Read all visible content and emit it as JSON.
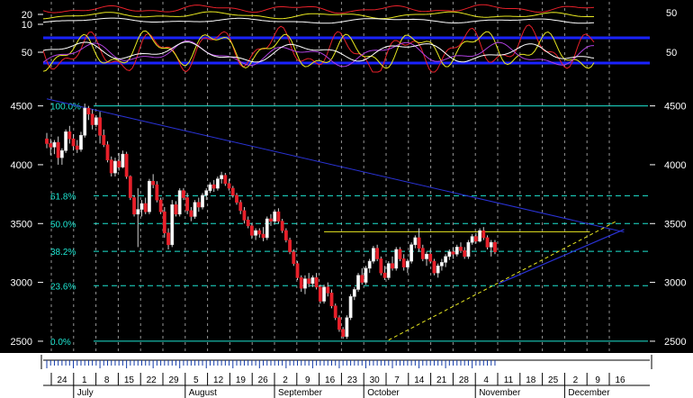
{
  "chart_data": {
    "type": "candlestick",
    "colors": {
      "background": "#000000",
      "axis_panel": "#ffffff",
      "up_candle": "#ffffff",
      "down_candle": "#e8202a",
      "wick": "#cfcfcf",
      "fib_lines": "#1ee6d2",
      "trendlines": "#2a33d6",
      "resistance": "#e8e820",
      "support_dashed": "#e8e820",
      "vgrid": "#c8c8c8",
      "osc_bands": "#1a22ff"
    },
    "indicator_panel": {
      "left_ticks": [
        "20",
        "10",
        "50"
      ],
      "right_ticks": [
        "50",
        "50"
      ],
      "band_levels": [
        80,
        20
      ],
      "lines": [
        {
          "color": "#e8202a",
          "kind": "upper"
        },
        {
          "color": "#e8e820",
          "kind": "upper"
        },
        {
          "color": "#ffffff",
          "kind": "upper"
        },
        {
          "color": "#e8202a",
          "kind": "oscillator"
        },
        {
          "color": "#e8e820",
          "kind": "oscillator"
        },
        {
          "color": "#b040e0",
          "kind": "oscillator"
        },
        {
          "color": "#ffffff",
          "kind": "oscillator"
        }
      ]
    },
    "price_axis": {
      "min": 2400,
      "max": 4650,
      "ticks": [
        "2500",
        "3000",
        "3500",
        "4000",
        "4500"
      ]
    },
    "fibonacci": {
      "high": 4500,
      "low": 2500,
      "levels": [
        {
          "label": "100.0%",
          "value": 4500
        },
        {
          "label": "61.8%",
          "value": 3736
        },
        {
          "label": "50.0%",
          "value": 3500
        },
        {
          "label": "38.2%",
          "value": 3264
        },
        {
          "label": "23.6%",
          "value": 2972
        },
        {
          "label": "0.0%",
          "value": 2500
        }
      ]
    },
    "resistance": {
      "value": 3430,
      "from_bar": 73,
      "to_bar": 143
    },
    "trendlines": [
      {
        "from": [
          0,
          4560
        ],
        "to": [
          145,
          3480
        ],
        "extend_to": 152
      },
      {
        "from": [
          119,
          2990
        ],
        "to": [
          152,
          3450
        ]
      }
    ],
    "support_dashed": {
      "from": [
        90,
        2510
      ],
      "to": [
        150,
        3520
      ]
    },
    "x_axis": {
      "day_labels": [
        "24",
        "1",
        "8",
        "15",
        "22",
        "29",
        "5",
        "12",
        "19",
        "26",
        "2",
        "9",
        "16",
        "23",
        "30",
        "7",
        "14",
        "21",
        "28",
        "4",
        "11",
        "18",
        "25",
        "2",
        "9",
        "16"
      ],
      "months": [
        {
          "label": "July",
          "at": 1
        },
        {
          "label": "August",
          "at": 6
        },
        {
          "label": "September",
          "at": 10
        },
        {
          "label": "October",
          "at": 14
        },
        {
          "label": "November",
          "at": 19
        },
        {
          "label": "December",
          "at": 23
        }
      ]
    },
    "candles": [
      {
        "o": 4220,
        "h": 4270,
        "l": 4140,
        "c": 4180
      },
      {
        "o": 4180,
        "h": 4220,
        "l": 4080,
        "c": 4150
      },
      {
        "o": 4150,
        "h": 4210,
        "l": 4090,
        "c": 4190
      },
      {
        "o": 4190,
        "h": 4240,
        "l": 4000,
        "c": 4060
      },
      {
        "o": 4060,
        "h": 4140,
        "l": 4000,
        "c": 4120
      },
      {
        "o": 4120,
        "h": 4300,
        "l": 4100,
        "c": 4280
      },
      {
        "o": 4280,
        "h": 4330,
        "l": 4180,
        "c": 4220
      },
      {
        "o": 4220,
        "h": 4260,
        "l": 4120,
        "c": 4160
      },
      {
        "o": 4160,
        "h": 4210,
        "l": 4100,
        "c": 4130
      },
      {
        "o": 4130,
        "h": 4280,
        "l": 4110,
        "c": 4250
      },
      {
        "o": 4250,
        "h": 4520,
        "l": 4230,
        "c": 4480
      },
      {
        "o": 4480,
        "h": 4500,
        "l": 4380,
        "c": 4430
      },
      {
        "o": 4430,
        "h": 4470,
        "l": 4300,
        "c": 4340
      },
      {
        "o": 4340,
        "h": 4420,
        "l": 4320,
        "c": 4400
      },
      {
        "o": 4400,
        "h": 4450,
        "l": 4180,
        "c": 4250
      },
      {
        "o": 4250,
        "h": 4300,
        "l": 4150,
        "c": 4170
      },
      {
        "o": 4170,
        "h": 4200,
        "l": 4020,
        "c": 4040
      },
      {
        "o": 4040,
        "h": 4070,
        "l": 3900,
        "c": 3930
      },
      {
        "o": 3930,
        "h": 4060,
        "l": 3900,
        "c": 4030
      },
      {
        "o": 4030,
        "h": 4100,
        "l": 3950,
        "c": 3980
      },
      {
        "o": 3980,
        "h": 4120,
        "l": 3970,
        "c": 4090
      },
      {
        "o": 4090,
        "h": 4110,
        "l": 3880,
        "c": 3900
      },
      {
        "o": 3900,
        "h": 3910,
        "l": 3700,
        "c": 3720
      },
      {
        "o": 3720,
        "h": 3740,
        "l": 3560,
        "c": 3580
      },
      {
        "o": 3580,
        "h": 3800,
        "l": 3300,
        "c": 3620
      },
      {
        "o": 3620,
        "h": 3700,
        "l": 3560,
        "c": 3670
      },
      {
        "o": 3670,
        "h": 3720,
        "l": 3580,
        "c": 3600
      },
      {
        "o": 3600,
        "h": 3880,
        "l": 3580,
        "c": 3860
      },
      {
        "o": 3860,
        "h": 3920,
        "l": 3800,
        "c": 3830
      },
      {
        "o": 3830,
        "h": 3860,
        "l": 3680,
        "c": 3700
      },
      {
        "o": 3700,
        "h": 3720,
        "l": 3580,
        "c": 3600
      },
      {
        "o": 3600,
        "h": 3640,
        "l": 3380,
        "c": 3420
      },
      {
        "o": 3420,
        "h": 3460,
        "l": 3280,
        "c": 3320
      },
      {
        "o": 3320,
        "h": 3700,
        "l": 3300,
        "c": 3660
      },
      {
        "o": 3660,
        "h": 3690,
        "l": 3560,
        "c": 3580
      },
      {
        "o": 3580,
        "h": 3800,
        "l": 3560,
        "c": 3780
      },
      {
        "o": 3780,
        "h": 3800,
        "l": 3700,
        "c": 3720
      },
      {
        "o": 3720,
        "h": 3760,
        "l": 3580,
        "c": 3610
      },
      {
        "o": 3610,
        "h": 3640,
        "l": 3520,
        "c": 3560
      },
      {
        "o": 3560,
        "h": 3700,
        "l": 3540,
        "c": 3680
      },
      {
        "o": 3680,
        "h": 3720,
        "l": 3600,
        "c": 3640
      },
      {
        "o": 3640,
        "h": 3760,
        "l": 3620,
        "c": 3740
      },
      {
        "o": 3740,
        "h": 3800,
        "l": 3700,
        "c": 3780
      },
      {
        "o": 3780,
        "h": 3850,
        "l": 3760,
        "c": 3830
      },
      {
        "o": 3830,
        "h": 3870,
        "l": 3770,
        "c": 3800
      },
      {
        "o": 3800,
        "h": 3900,
        "l": 3780,
        "c": 3880
      },
      {
        "o": 3880,
        "h": 3940,
        "l": 3840,
        "c": 3910
      },
      {
        "o": 3910,
        "h": 3930,
        "l": 3820,
        "c": 3840
      },
      {
        "o": 3840,
        "h": 3880,
        "l": 3780,
        "c": 3800
      },
      {
        "o": 3800,
        "h": 3820,
        "l": 3720,
        "c": 3740
      },
      {
        "o": 3740,
        "h": 3760,
        "l": 3660,
        "c": 3680
      },
      {
        "o": 3680,
        "h": 3700,
        "l": 3580,
        "c": 3610
      },
      {
        "o": 3610,
        "h": 3640,
        "l": 3500,
        "c": 3530
      },
      {
        "o": 3530,
        "h": 3560,
        "l": 3460,
        "c": 3480
      },
      {
        "o": 3480,
        "h": 3500,
        "l": 3370,
        "c": 3400
      },
      {
        "o": 3400,
        "h": 3460,
        "l": 3360,
        "c": 3440
      },
      {
        "o": 3440,
        "h": 3460,
        "l": 3380,
        "c": 3410
      },
      {
        "o": 3410,
        "h": 3470,
        "l": 3350,
        "c": 3380
      },
      {
        "o": 3380,
        "h": 3560,
        "l": 3360,
        "c": 3540
      },
      {
        "o": 3540,
        "h": 3580,
        "l": 3480,
        "c": 3520
      },
      {
        "o": 3520,
        "h": 3620,
        "l": 3500,
        "c": 3600
      },
      {
        "o": 3600,
        "h": 3630,
        "l": 3500,
        "c": 3520
      },
      {
        "o": 3520,
        "h": 3540,
        "l": 3420,
        "c": 3440
      },
      {
        "o": 3440,
        "h": 3460,
        "l": 3340,
        "c": 3360
      },
      {
        "o": 3360,
        "h": 3380,
        "l": 3240,
        "c": 3260
      },
      {
        "o": 3260,
        "h": 3280,
        "l": 3140,
        "c": 3160
      },
      {
        "o": 3160,
        "h": 3180,
        "l": 3020,
        "c": 3040
      },
      {
        "o": 3040,
        "h": 3060,
        "l": 2920,
        "c": 2950
      },
      {
        "o": 2950,
        "h": 3060,
        "l": 2900,
        "c": 3030
      },
      {
        "o": 3030,
        "h": 3080,
        "l": 2960,
        "c": 2990
      },
      {
        "o": 2990,
        "h": 3060,
        "l": 2960,
        "c": 3040
      },
      {
        "o": 3040,
        "h": 3080,
        "l": 2940,
        "c": 2960
      },
      {
        "o": 2960,
        "h": 2980,
        "l": 2820,
        "c": 2840
      },
      {
        "o": 2840,
        "h": 2980,
        "l": 2820,
        "c": 2960
      },
      {
        "o": 2960,
        "h": 3000,
        "l": 2880,
        "c": 2910
      },
      {
        "o": 2910,
        "h": 2940,
        "l": 2780,
        "c": 2800
      },
      {
        "o": 2800,
        "h": 2820,
        "l": 2680,
        "c": 2700
      },
      {
        "o": 2700,
        "h": 2720,
        "l": 2580,
        "c": 2600
      },
      {
        "o": 2600,
        "h": 2620,
        "l": 2520,
        "c": 2540
      },
      {
        "o": 2540,
        "h": 2720,
        "l": 2520,
        "c": 2700
      },
      {
        "o": 2700,
        "h": 2900,
        "l": 2680,
        "c": 2880
      },
      {
        "o": 2880,
        "h": 2960,
        "l": 2850,
        "c": 2940
      },
      {
        "o": 2940,
        "h": 3080,
        "l": 2920,
        "c": 3060
      },
      {
        "o": 3060,
        "h": 3120,
        "l": 2980,
        "c": 3000
      },
      {
        "o": 3000,
        "h": 3140,
        "l": 2980,
        "c": 3120
      },
      {
        "o": 3120,
        "h": 3200,
        "l": 3080,
        "c": 3180
      },
      {
        "o": 3180,
        "h": 3310,
        "l": 3160,
        "c": 3290
      },
      {
        "o": 3290,
        "h": 3320,
        "l": 3180,
        "c": 3200
      },
      {
        "o": 3200,
        "h": 3220,
        "l": 3060,
        "c": 3080
      },
      {
        "o": 3080,
        "h": 3140,
        "l": 3020,
        "c": 3040
      },
      {
        "o": 3040,
        "h": 3180,
        "l": 3020,
        "c": 3160
      },
      {
        "o": 3160,
        "h": 3220,
        "l": 3100,
        "c": 3120
      },
      {
        "o": 3120,
        "h": 3300,
        "l": 3100,
        "c": 3280
      },
      {
        "o": 3280,
        "h": 3300,
        "l": 3180,
        "c": 3200
      },
      {
        "o": 3200,
        "h": 3240,
        "l": 3100,
        "c": 3130
      },
      {
        "o": 3130,
        "h": 3200,
        "l": 3080,
        "c": 3180
      },
      {
        "o": 3180,
        "h": 3340,
        "l": 3160,
        "c": 3320
      },
      {
        "o": 3320,
        "h": 3400,
        "l": 3290,
        "c": 3380
      },
      {
        "o": 3380,
        "h": 3460,
        "l": 3260,
        "c": 3290
      },
      {
        "o": 3290,
        "h": 3320,
        "l": 3180,
        "c": 3200
      },
      {
        "o": 3200,
        "h": 3260,
        "l": 3140,
        "c": 3240
      },
      {
        "o": 3240,
        "h": 3280,
        "l": 3160,
        "c": 3180
      },
      {
        "o": 3180,
        "h": 3200,
        "l": 3060,
        "c": 3080
      },
      {
        "o": 3080,
        "h": 3160,
        "l": 3040,
        "c": 3140
      },
      {
        "o": 3140,
        "h": 3200,
        "l": 3100,
        "c": 3170
      },
      {
        "o": 3170,
        "h": 3240,
        "l": 3130,
        "c": 3220
      },
      {
        "o": 3220,
        "h": 3280,
        "l": 3190,
        "c": 3260
      },
      {
        "o": 3260,
        "h": 3300,
        "l": 3200,
        "c": 3240
      },
      {
        "o": 3240,
        "h": 3320,
        "l": 3220,
        "c": 3300
      },
      {
        "o": 3300,
        "h": 3340,
        "l": 3250,
        "c": 3270
      },
      {
        "o": 3270,
        "h": 3300,
        "l": 3200,
        "c": 3220
      },
      {
        "o": 3220,
        "h": 3360,
        "l": 3200,
        "c": 3340
      },
      {
        "o": 3340,
        "h": 3410,
        "l": 3320,
        "c": 3390
      },
      {
        "o": 3390,
        "h": 3420,
        "l": 3330,
        "c": 3350
      },
      {
        "o": 3350,
        "h": 3460,
        "l": 3340,
        "c": 3440
      },
      {
        "o": 3440,
        "h": 3470,
        "l": 3360,
        "c": 3380
      },
      {
        "o": 3380,
        "h": 3400,
        "l": 3280,
        "c": 3300
      },
      {
        "o": 3300,
        "h": 3360,
        "l": 3220,
        "c": 3340
      },
      {
        "o": 3340,
        "h": 3360,
        "l": 3240,
        "c": 3260
      }
    ]
  }
}
